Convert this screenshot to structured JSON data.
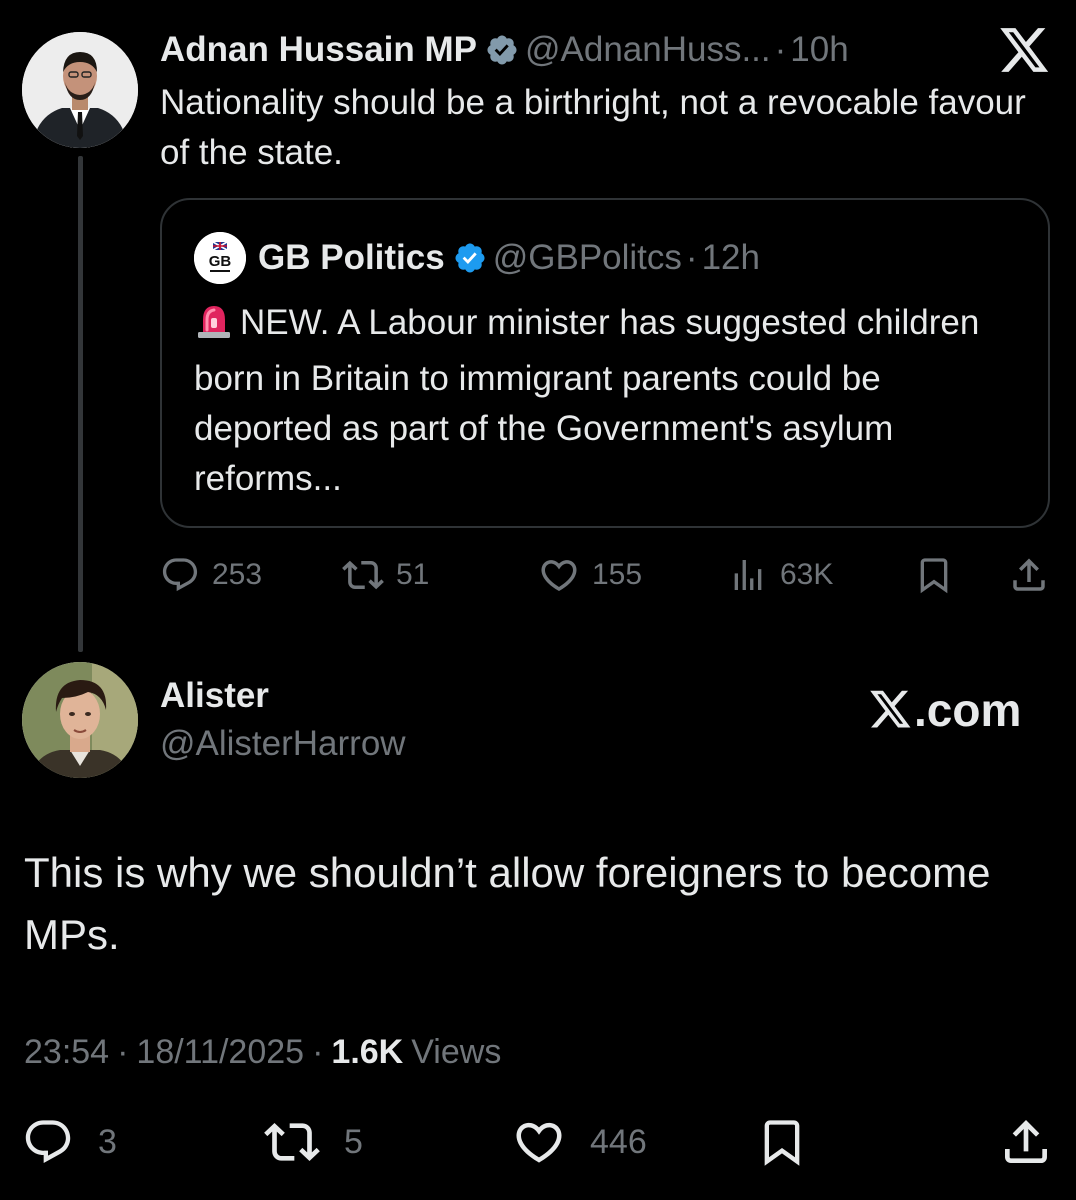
{
  "parent_tweet": {
    "author_name": "Adnan Hussain MP",
    "handle": "@AdnanHuss...",
    "separator": "·",
    "time": "10h",
    "text": "Nationality should be a birthright, not a revocable favour of the state.",
    "quoted_tweet": {
      "author_name": "GB Politics",
      "avatar_text": "GB",
      "handle": "@GBPolitcs",
      "separator": "·",
      "time": "12h",
      "text": "NEW. A Labour minister has suggested children born in Britain to immigrant parents could be deported as part of the Government's asylum reforms..."
    },
    "actions": {
      "replies": "253",
      "reposts": "51",
      "likes": "155",
      "views": "63K"
    }
  },
  "reply_tweet": {
    "author_name": "Alister",
    "handle": "@AlisterHarrow",
    "watermark": ".com",
    "text": "This is why we shouldn’t allow foreigners to become MPs.",
    "meta": {
      "time": "23:54",
      "separator": "·",
      "date": "18/11/2025",
      "views_count": "1.6K",
      "views_label": "Views"
    },
    "actions": {
      "replies": "3",
      "reposts": "5",
      "likes": "446"
    }
  },
  "icons": {
    "verified": "verified-badge-icon",
    "x_logo": "x-logo-icon",
    "reply": "speech-bubble-icon",
    "repost": "repost-arrows-icon",
    "like": "heart-icon",
    "views": "bar-chart-icon",
    "bookmark": "bookmark-icon",
    "share": "share-upload-icon",
    "siren": "siren-emoji-icon"
  },
  "colors": {
    "background": "#000000",
    "text_primary": "#e7e9ea",
    "text_secondary": "#71767b",
    "verified_blue": "#1d9bf0",
    "border": "#2f3336"
  }
}
